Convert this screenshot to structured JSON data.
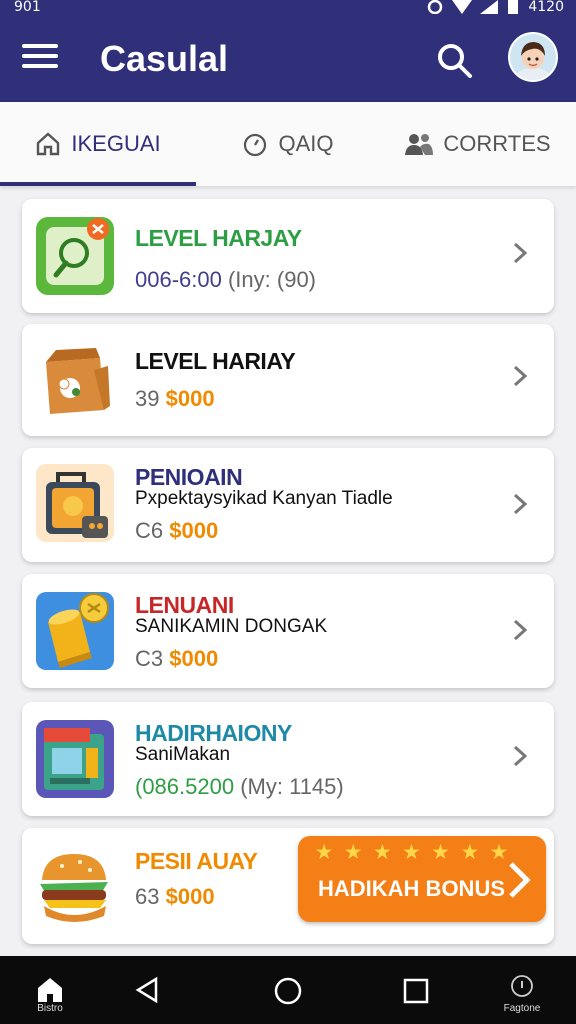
{
  "status": {
    "time": "901",
    "clock_right": "4120"
  },
  "appbar": {
    "title": "Casulal",
    "icons": [
      "menu-icon",
      "search-icon",
      "avatar"
    ]
  },
  "tabs": [
    {
      "label": "IKEGUAI",
      "icon": "home-outline-icon",
      "active": true
    },
    {
      "label": "QAIQ",
      "icon": "timer-icon",
      "active": false
    },
    {
      "label": "CORRTES",
      "icon": "people-icon",
      "active": false
    }
  ],
  "cards": [
    {
      "title": "LEVEL HARJAY",
      "title_color": "#2e9e44",
      "sub": "",
      "meta_plain": "006-6:00",
      "meta_plain_color": "#3f3f8f",
      "meta_price": "",
      "meta_extra": "(Iny: (90)",
      "icon": "game-tile-icon"
    },
    {
      "title": "LEVEL HARIAY",
      "title_color": "#111111",
      "sub": "",
      "meta_plain": "39",
      "meta_plain_color": "#666666",
      "meta_price": "$000",
      "meta_extra": "",
      "icon": "paper-bag-icon"
    },
    {
      "title": "PENIOAIN",
      "title_color": "#2f2f7a",
      "sub": "Pxpektaysyikad Kanyan Tiadle",
      "meta_plain": "C6",
      "meta_plain_color": "#666666",
      "meta_price": "$000",
      "meta_extra": "",
      "icon": "lock-box-icon"
    },
    {
      "title": "LENUANI",
      "title_color": "#c62828",
      "sub": "SANIKAMIN DONGAK",
      "meta_plain": "C3",
      "meta_plain_color": "#666666",
      "meta_price": "$000",
      "meta_extra": "",
      "icon": "gold-cup-icon"
    },
    {
      "title": "HADIRHAIONY",
      "title_color": "#1f8aa8",
      "sub": "SaniMakan",
      "meta_plain": "(086.5200",
      "meta_plain_color": "#2e9e44",
      "meta_price": "",
      "meta_extra": "(My: 1145)",
      "icon": "vending-box-icon"
    },
    {
      "title": "PESII AUAY",
      "title_color": "#f08a00",
      "sub": "",
      "meta_plain": "63",
      "meta_plain_color": "#666666",
      "meta_price": "$000",
      "meta_extra": "",
      "icon": "burger-icon"
    }
  ],
  "bonus_button": {
    "label": "HADIKAH BONUS",
    "stars": "★ ★ ★ ★ ★ ★ ★"
  },
  "navbar": {
    "home_label": "Bistro",
    "info_label": "Fagtone"
  }
}
